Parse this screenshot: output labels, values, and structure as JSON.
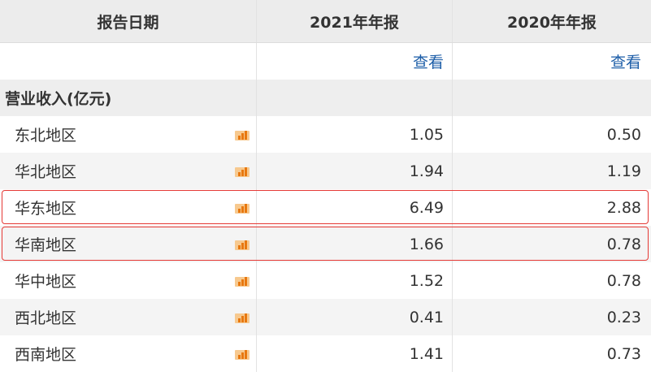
{
  "header": {
    "col1": "报告日期",
    "col2": "2021年年报",
    "col3": "2020年年报"
  },
  "links": {
    "col2": "查看",
    "col3": "查看"
  },
  "section": {
    "title": "营业收入(亿元)"
  },
  "rows": [
    {
      "region": "东北地区",
      "v2021": "1.05",
      "v2020": "0.50"
    },
    {
      "region": "华北地区",
      "v2021": "1.94",
      "v2020": "1.19"
    },
    {
      "region": "华东地区",
      "v2021": "6.49",
      "v2020": "2.88"
    },
    {
      "region": "华南地区",
      "v2021": "1.66",
      "v2020": "0.78"
    },
    {
      "region": "华中地区",
      "v2021": "1.52",
      "v2020": "0.78"
    },
    {
      "region": "西北地区",
      "v2021": "0.41",
      "v2020": "0.23"
    },
    {
      "region": "西南地区",
      "v2021": "1.41",
      "v2020": "0.73"
    }
  ],
  "colors": {
    "highlight": "#e53935",
    "link": "#1d5ea8",
    "icon": "#e8780f"
  },
  "icons": {
    "row_icon": "bar-chart-icon"
  }
}
